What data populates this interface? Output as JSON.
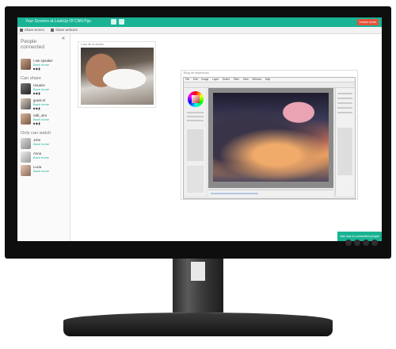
{
  "topbar": {
    "title": "Your Screens at LookUp Of CNN Pgs",
    "leave_label": "Leave room"
  },
  "subbar": {
    "share_screen": "Share screen",
    "share_webcam": "Share webcam"
  },
  "sidebar": {
    "heading": "People connected",
    "can_share_heading": "Can share",
    "can_watch_heading": "Only can watch",
    "me": {
      "name": "I am speaker",
      "link": "Back home"
    },
    "sharers": [
      {
        "name": "Usuario",
        "link": "Back home"
      },
      {
        "name": "guest.el",
        "link": "Back home"
      },
      {
        "name": "ratb_otro",
        "link": "Back home"
      }
    ],
    "watchers": [
      {
        "name": "John",
        "link": "Back home"
      },
      {
        "name": "Anna",
        "link": "Back home"
      },
      {
        "name": "Lucia",
        "link": "Back home"
      }
    ]
  },
  "cam_panel": {
    "caption": "Cam de la sesión"
  },
  "share_panel": {
    "caption": "Blog de esperanza"
  },
  "paint_app": {
    "menu": [
      "File",
      "Edit",
      "Image",
      "Layer",
      "Select",
      "Filter",
      "View",
      "Window",
      "Help"
    ]
  },
  "footer": {
    "access_label": "Ask now to connected people"
  },
  "colors": {
    "accent": "#1ab394",
    "danger": "#e5533c"
  }
}
